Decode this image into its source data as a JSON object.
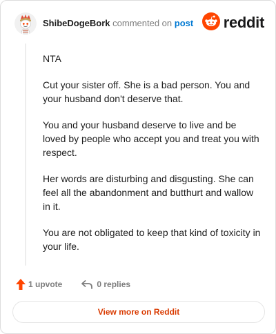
{
  "header": {
    "username": "ShibeDogeBork",
    "commented_text": "commented on",
    "post_link": "post",
    "brand_wordmark": "reddit"
  },
  "comment": {
    "paragraphs": [
      "NTA",
      "Cut your sister off. She is a bad person. You and your husband don't deserve that.",
      "You and your husband deserve to live and be loved by people who accept you and treat you with respect.",
      "Her words are disturbing and disgusting. She can feel all the abandonment and butthurt and wallow in it.",
      "You are not obligated to keep that kind of toxicity in your life."
    ]
  },
  "footer": {
    "upvote_label": "1 upvote",
    "replies_label": "0 replies",
    "view_button": "View more on Reddit"
  },
  "colors": {
    "brand_orange": "#ff4500",
    "link_blue": "#0079d3",
    "button_text": "#d93a00",
    "muted": "#7c7c7c"
  },
  "icons": [
    "snoo-avatar-icon",
    "reddit-logo-icon",
    "upvote-arrow-icon",
    "reply-arrow-icon"
  ]
}
